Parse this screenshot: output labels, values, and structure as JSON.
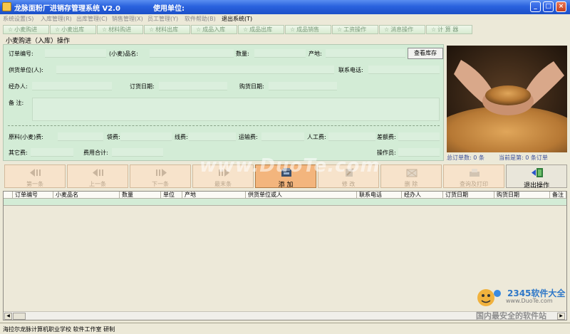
{
  "titlebar": {
    "title": "龙脉面粉厂进销存管理系统 V2.0",
    "unit_label": "使用单位:",
    "minimize": "_",
    "maximize": "□",
    "close": "×"
  },
  "menu": [
    "系统设置(S)",
    "入库管理(R)",
    "出库管理(C)",
    "销售管理(X)",
    "员工管理(Y)",
    "软件帮助(B)",
    "退出系统(T)"
  ],
  "tabs": [
    "小麦购进",
    "小麦出库",
    "材料购进",
    "材料出库",
    "成品入库",
    "成品出库",
    "成品销售",
    "工资操作",
    "消息操作",
    "计 算 器"
  ],
  "section_title": "小麦购进（入库）操作",
  "form": {
    "order_no": "订单编号:",
    "wheat_name": "(小麦)品名:",
    "quantity": "数量:",
    "origin": "产地:",
    "supplier": "供货单位(人):",
    "contact_phone": "联系电话:",
    "handler": "经办人:",
    "order_date": "订货日期:",
    "purchase_date": "购货日期:",
    "remark": "备  注:",
    "raw_cost": "原料(小麦)费:",
    "bag_fee": "袋费:",
    "thread_fee": "线费:",
    "freight": "运输费:",
    "labor": "人工费:",
    "difference": "差额费:",
    "other": "其它费:",
    "total_cost": "费用合计:",
    "operator": "操作员:",
    "view_stock": "查看库存"
  },
  "stats": {
    "total_orders": "总订单数: 0 条",
    "current": "当前是第: 0 条订单"
  },
  "toolbar": {
    "first": "第一条",
    "prev": "上一条",
    "next": "下一条",
    "last": "最末条",
    "add": "添  加",
    "modify": "修  改",
    "delete": "删  除",
    "query_print": "查询及打印",
    "exit": "退出操作"
  },
  "grid": {
    "columns": [
      "订单编号",
      "小麦品名",
      "数量",
      "单位",
      "产地",
      "供货单位或人",
      "联系电话",
      "经办人",
      "订货日期",
      "购货日期",
      "备注"
    ]
  },
  "status": "海拉尔龙脉计算机职业学校 软件工作室 研制",
  "watermarks": {
    "duote": "www.DuoTe.com",
    "brand": "2345软件大全",
    "url": "www.DuoTe.com",
    "slogan": "国内最安全的软件站"
  },
  "colors": {
    "title_blue": "#2a62de",
    "form_green": "#d3ecd6",
    "toolbar_peach": "#f7e3cb",
    "active_button": "#f3b57d"
  }
}
